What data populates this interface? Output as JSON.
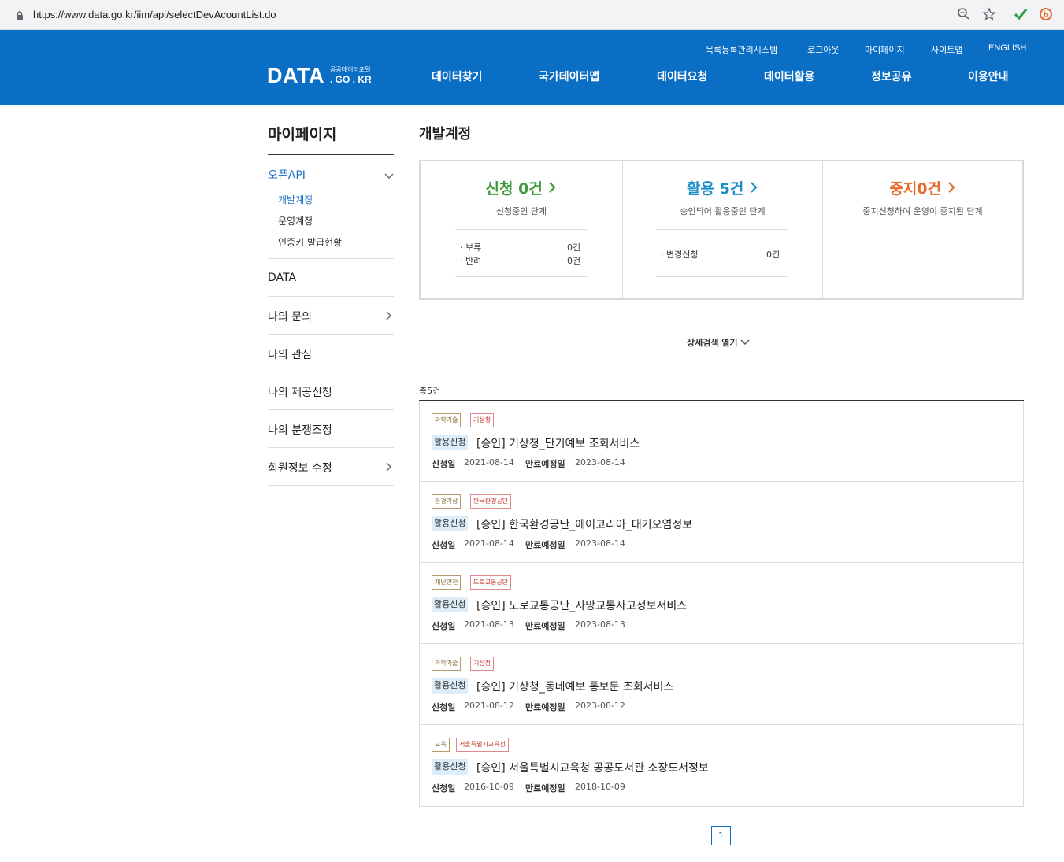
{
  "browser": {
    "url": "https://www.data.go.kr/iim/api/selectDevAcountList.do"
  },
  "header": {
    "util_links": [
      "목록등록관리시스템",
      "로그아웃",
      "마이페이지",
      "사이트맵",
      "ENGLISH"
    ],
    "logo_main": "DATA",
    "logo_sub1": "공공데이터포털",
    "logo_sub2": ". GO . KR",
    "nav": [
      "데이터찾기",
      "국가데이터맵",
      "데이터요청",
      "데이터활용",
      "정보공유",
      "이용안내"
    ]
  },
  "sidebar": {
    "title": "마이페이지",
    "open_api": "오픈API",
    "open_api_sub": [
      "개발계정",
      "운영계정",
      "인증키 발급현황"
    ],
    "items": [
      "DATA",
      "나의 문의",
      "나의 관심",
      "나의 제공신청",
      "나의 분쟁조정",
      "회원정보 수정"
    ]
  },
  "main": {
    "title": "개발계정",
    "status": {
      "apply": {
        "head": "신청 0건",
        "desc": "신청중인 단계",
        "rows": [
          {
            "label": "· 보류",
            "value": "0건"
          },
          {
            "label": "· 반려",
            "value": "0건"
          }
        ],
        "color": "#3a9a3a"
      },
      "use": {
        "head": "활용 5건",
        "desc": "승인되어 활용중인 단계",
        "rows": [
          {
            "label": "· 변경신청",
            "value": "0건"
          }
        ],
        "color": "#1b8fc9"
      },
      "stop": {
        "head": "중지0건",
        "desc": "중지신청하여 운영이 중지된 단계",
        "color": "#e8682a"
      }
    },
    "detail_toggle": "상세검색 열기",
    "total": "총5건",
    "list": [
      {
        "cat": "과학기술",
        "org": "기상청",
        "badge": "활용신청",
        "title": "[승인] 기상청_단기예보 조회서비스",
        "apply_label": "신청일",
        "apply_date": "2021-08-14",
        "expire_label": "만료예정일",
        "expire_date": "2023-08-14"
      },
      {
        "cat": "환경기상",
        "org": "한국환경공단",
        "badge": "활용신청",
        "title": "[승인] 한국환경공단_에어코리아_대기오염정보",
        "apply_label": "신청일",
        "apply_date": "2021-08-14",
        "expire_label": "만료예정일",
        "expire_date": "2023-08-14"
      },
      {
        "cat": "재난안전",
        "org": "도로교통공단",
        "badge": "활용신청",
        "title": "[승인] 도로교통공단_사망교통사고정보서비스",
        "apply_label": "신청일",
        "apply_date": "2021-08-13",
        "expire_label": "만료예정일",
        "expire_date": "2023-08-13"
      },
      {
        "cat": "과학기술",
        "org": "기상청",
        "badge": "활용신청",
        "title": "[승인] 기상청_동네예보 통보문 조회서비스",
        "apply_label": "신청일",
        "apply_date": "2021-08-12",
        "expire_label": "만료예정일",
        "expire_date": "2023-08-12"
      },
      {
        "cat": "교육",
        "org": "서울특별시교육청",
        "badge": "활용신청",
        "title": "[승인] 서울특별시교육청 공공도서관 소장도서정보",
        "apply_label": "신청일",
        "apply_date": "2016-10-09",
        "expire_label": "만료예정일",
        "expire_date": "2018-10-09"
      }
    ],
    "page": "1"
  }
}
